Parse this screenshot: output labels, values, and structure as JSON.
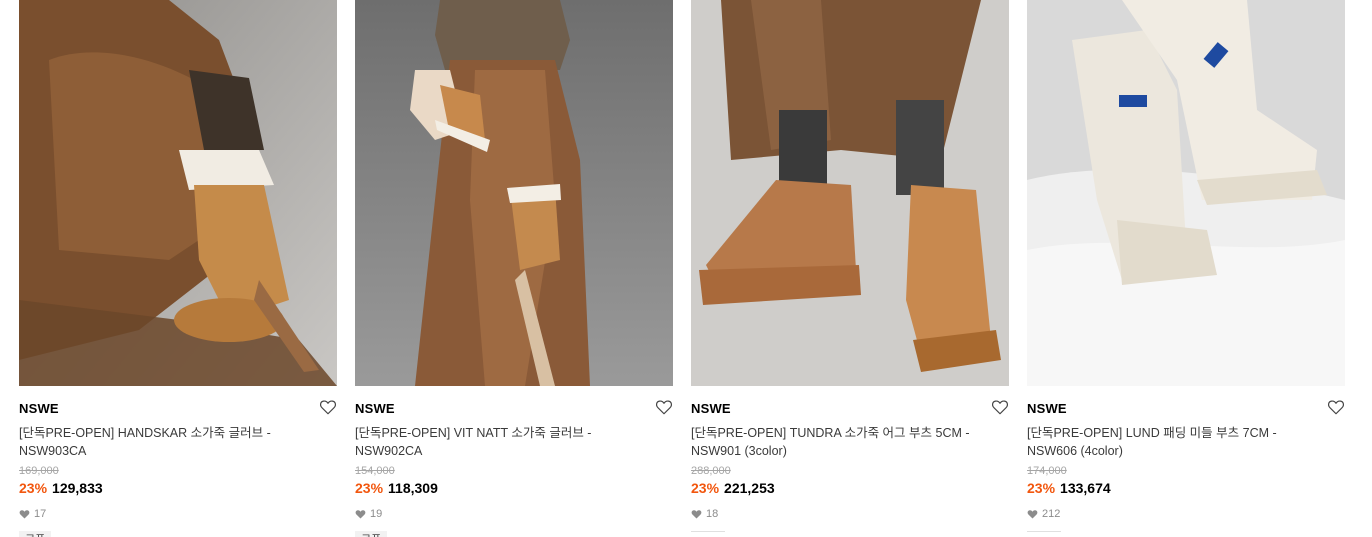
{
  "products": [
    {
      "brand": "NSWE",
      "title": "[단독PRE-OPEN] HANDSKAR 소가죽 글러브 -NSW903CA",
      "original_price": "169,000",
      "discount": "23%",
      "price": "129,833",
      "likes": "17",
      "coupon": "쿠폰",
      "image_desc": "model-with-suede-gloves-icon"
    },
    {
      "brand": "NSWE",
      "title": "[단독PRE-OPEN] VIT NATT 소가죽 글러브 -NSW902CA",
      "original_price": "154,000",
      "discount": "23%",
      "price": "118,309",
      "likes": "19",
      "coupon": "쿠폰",
      "image_desc": "model-in-brown-dress-icon"
    },
    {
      "brand": "NSWE",
      "title": "[단독PRE-OPEN] TUNDRA 소가죽 어그 부츠 5CM -NSW901 (3color)",
      "original_price": "288,000",
      "discount": "23%",
      "price": "221,253",
      "likes": "18",
      "coupon": "",
      "image_desc": "suede-ankle-boots-icon"
    },
    {
      "brand": "NSWE",
      "title": "[단독PRE-OPEN] LUND 패딩 미들 부츠 7CM -NSW606 (4color)",
      "original_price": "174,000",
      "discount": "23%",
      "price": "133,674",
      "likes": "212",
      "coupon": "",
      "image_desc": "padded-boots-in-snow-icon"
    }
  ],
  "colors": {
    "discount": "#f2570f",
    "price": "#000000",
    "muted": "#a6a6a6"
  }
}
